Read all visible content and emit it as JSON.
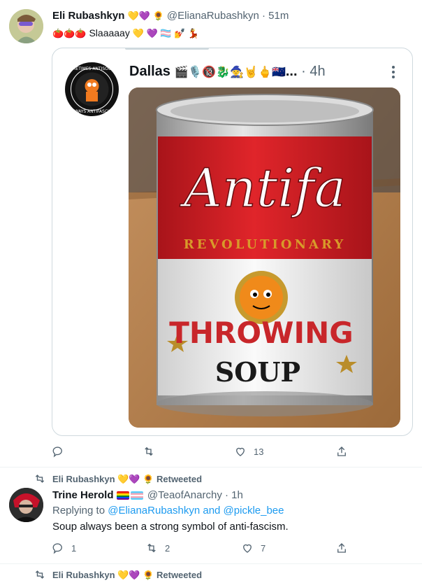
{
  "tweet1": {
    "author_name": "Eli Rubashkyn",
    "author_emojis": "💛💜 🌻",
    "handle_time": "@ElianaRubashkyn · 51m",
    "text": "Slaaaaay",
    "text_prefix_emojis": "🍅🍅🍅",
    "text_suffix_emojis": "💛 💜 🏳️‍⚧️ 💅 💃",
    "quoted": {
      "partial_header": "",
      "author_name": "Dallas",
      "author_emojis": "🎬🎙️🔞🐉🧙🤘🖕🇳🇿",
      "ellipsis": "...",
      "time": "· 4h",
      "avatar_ring_text_top": "SOMETIMES ANTISOCIAL",
      "avatar_ring_text_bottom": "ALWAYS ANTIFASCIST",
      "can": {
        "script": "Antifa",
        "subtitle": "REVOLUTIONARY",
        "word1": "THROWING",
        "word2": "SOUP"
      }
    },
    "actions": {
      "reply": "",
      "retweet": "",
      "like": "13",
      "share": ""
    }
  },
  "retweet_label": {
    "name": "Eli Rubashkyn",
    "emojis": "💛💜 🌻",
    "suffix": "Retweeted"
  },
  "tweet2": {
    "author_name": "Trine Herold",
    "handle_time": "@TeaofAnarchy · 1h",
    "replying_prefix": "Replying to",
    "replying_users": "@ElianaRubashkyn and @pickle_bee",
    "text": "Soup always been a strong symbol of anti-fascism.",
    "actions": {
      "reply": "1",
      "retweet": "2",
      "like": "7",
      "share": ""
    }
  },
  "retweet_label_2": {
    "name": "Eli Rubashkyn",
    "emojis": "💛💜 🌻",
    "suffix": "Retweeted"
  }
}
